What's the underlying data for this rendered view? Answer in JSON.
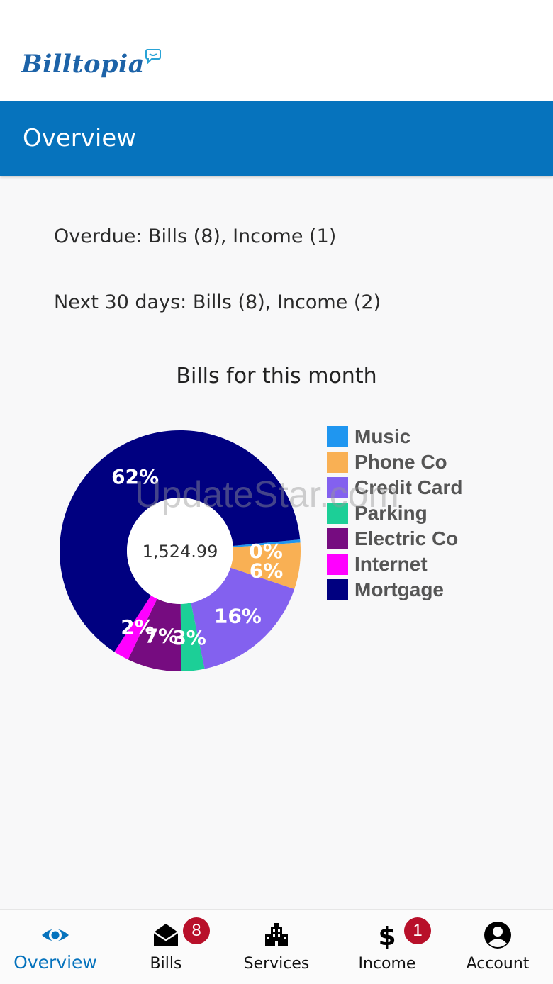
{
  "app": {
    "logo_text": "Billtopia"
  },
  "header": {
    "title": "Overview"
  },
  "summary": {
    "overdue": "Overdue: Bills (8), Income (1)",
    "next30": "Next 30 days: Bills (8), Income (2)"
  },
  "chart": {
    "title": "Bills for this month",
    "center_total": "1,524.99"
  },
  "chart_data": {
    "type": "pie",
    "title": "Bills for this month",
    "center_label": "1,524.99",
    "legend_position": "right",
    "slices": [
      {
        "name": "Music",
        "percent": 0,
        "label": "0%",
        "color": "#1f96f0"
      },
      {
        "name": "Phone Co",
        "percent": 6,
        "label": "6%",
        "color": "#f9b054"
      },
      {
        "name": "Credit Card",
        "percent": 16,
        "label": "16%",
        "color": "#8361ef"
      },
      {
        "name": "Parking",
        "percent": 3,
        "label": "3%",
        "color": "#1ccf97"
      },
      {
        "name": "Electric Co",
        "percent": 7,
        "label": "7%",
        "color": "#760c80"
      },
      {
        "name": "Internet",
        "percent": 2,
        "label": "2%",
        "color": "#ff00ff"
      },
      {
        "name": "Mortgage",
        "percent": 62,
        "label": "62%",
        "color": "#000080"
      }
    ]
  },
  "watermark": "UpdateStar.com",
  "nav": {
    "items": [
      {
        "label": "Overview",
        "icon": "eye-icon",
        "active": true
      },
      {
        "label": "Bills",
        "icon": "envelope-open-icon",
        "badge": "8"
      },
      {
        "label": "Services",
        "icon": "building-icon"
      },
      {
        "label": "Income",
        "icon": "dollar-icon",
        "badge": "1"
      },
      {
        "label": "Account",
        "icon": "user-circle-icon"
      }
    ]
  },
  "colors": {
    "brand": "#0673bd",
    "badge": "#b8102a"
  }
}
